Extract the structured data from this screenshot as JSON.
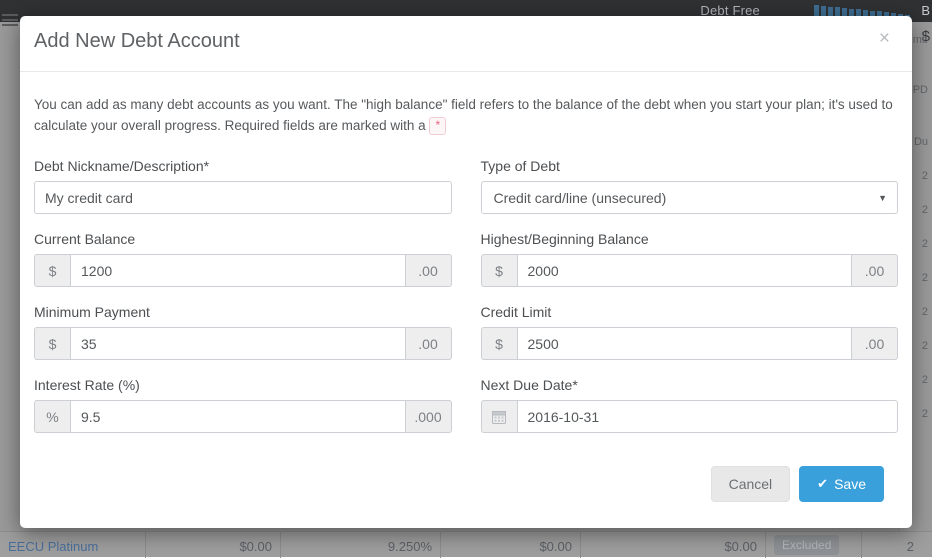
{
  "background": {
    "topbar": {
      "menu_icon": "hamburger-menu-icon",
      "debt_free_label": "Debt Free",
      "sparkline_icon": "sparkline-bar-chart-icon",
      "sparkline_values": [
        17,
        16,
        15,
        15,
        14,
        13,
        13,
        12,
        11,
        11,
        10,
        9,
        8,
        7
      ],
      "right_letter": "B",
      "right_amount_letter": "$"
    },
    "table": {
      "partial_headers": [
        "mt.",
        "PD"
      ],
      "partial_column_label": "Du",
      "partial_rows": [
        "2",
        "2",
        "2",
        "2",
        "2",
        "2",
        "2",
        "2"
      ],
      "bottom_row": {
        "name": "EECU Platinum",
        "balance": "$0.00",
        "rate": "9.250%",
        "payment": "$0.00",
        "extra": "$0.00",
        "status_badge": "Excluded",
        "due": "2"
      }
    }
  },
  "modal": {
    "title": "Add New Debt Account",
    "close_icon": "close-icon",
    "close_label": "×",
    "intro_before": "You can add as many debt accounts as you want. The \"high balance\" field refers to the balance of the debt when you start your plan; it's used to calculate your overall progress. Required fields are marked with a",
    "required_marker": "*",
    "fields": {
      "nickname": {
        "label": "Debt Nickname/Description*",
        "value": "My credit card",
        "placeholder": ""
      },
      "type_of_debt": {
        "label": "Type of Debt",
        "value": "Credit card/line (unsecured)",
        "caret_icon": "chevron-down-icon"
      },
      "current_balance": {
        "label": "Current Balance",
        "prefix": "$",
        "value": "1200",
        "suffix": ".00"
      },
      "highest_balance": {
        "label": "Highest/Beginning Balance",
        "prefix": "$",
        "value": "2000",
        "suffix": ".00"
      },
      "minimum_payment": {
        "label": "Minimum Payment",
        "prefix": "$",
        "value": "35",
        "suffix": ".00"
      },
      "credit_limit": {
        "label": "Credit Limit",
        "prefix": "$",
        "value": "2500",
        "suffix": ".00"
      },
      "interest_rate": {
        "label": "Interest Rate (%)",
        "prefix": "%",
        "value": "9.5",
        "suffix": ".000"
      },
      "next_due_date": {
        "label": "Next Due Date*",
        "prefix_icon": "calendar-icon",
        "value": "2016-10-31"
      }
    },
    "footer": {
      "cancel_label": "Cancel",
      "save_label": "Save",
      "save_icon": "check-icon",
      "save_icon_glyph": "✔"
    }
  },
  "colors": {
    "accent_blue": "#3aa0db",
    "modal_bg": "#ffffff",
    "page_bg": "#9a9a9a",
    "topbar_bg": "#2f3133",
    "addon_bg": "#eeeeee",
    "border": "#ccd0d4",
    "required_pink": "#e8637f"
  }
}
